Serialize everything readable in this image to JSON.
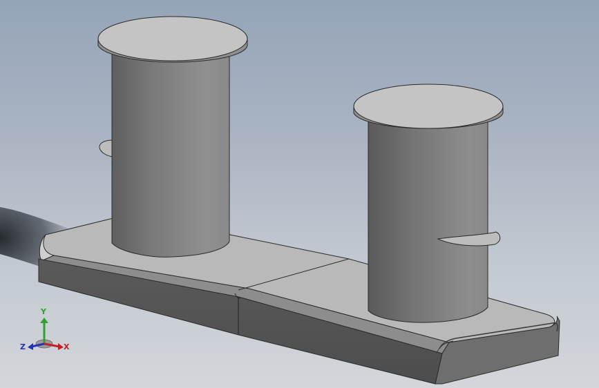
{
  "viewport": {
    "model": "bollard",
    "background_top": "#95a4b8",
    "background_bottom": "#d3d6da"
  },
  "triad": {
    "x_label": "X",
    "y_label": "Y",
    "z_label": "Z",
    "x_color": "#c0202a",
    "y_color": "#2fa12f",
    "z_color": "#2433b5"
  }
}
